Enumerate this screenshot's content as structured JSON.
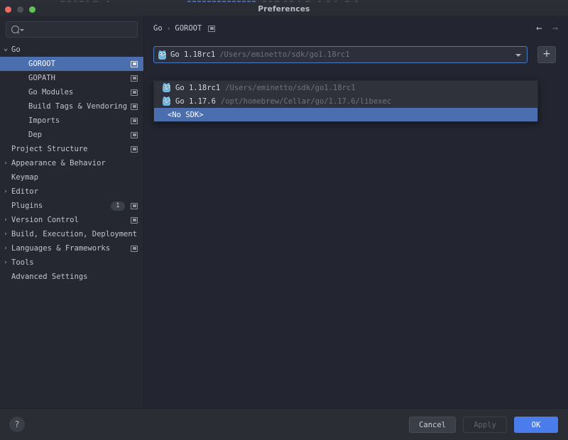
{
  "window": {
    "title": "Preferences",
    "traffic_lights": [
      "close",
      "minimize",
      "zoom"
    ]
  },
  "sidebar": {
    "search": {
      "placeholder": "",
      "value": "",
      "icon": "search-icon"
    },
    "items": [
      {
        "label": "Go",
        "indent": 0,
        "twisty": "expanded",
        "selected": false,
        "gutter": false,
        "count": null
      },
      {
        "label": "GOROOT",
        "indent": 1,
        "twisty": "none",
        "selected": true,
        "gutter": true,
        "count": null
      },
      {
        "label": "GOPATH",
        "indent": 1,
        "twisty": "none",
        "selected": false,
        "gutter": true,
        "count": null
      },
      {
        "label": "Go Modules",
        "indent": 1,
        "twisty": "none",
        "selected": false,
        "gutter": true,
        "count": null
      },
      {
        "label": "Build Tags & Vendoring",
        "indent": 1,
        "twisty": "none",
        "selected": false,
        "gutter": true,
        "count": null
      },
      {
        "label": "Imports",
        "indent": 1,
        "twisty": "none",
        "selected": false,
        "gutter": true,
        "count": null
      },
      {
        "label": "Dep",
        "indent": 1,
        "twisty": "none",
        "selected": false,
        "gutter": true,
        "count": null
      },
      {
        "label": "Project Structure",
        "indent": 0,
        "twisty": "none",
        "selected": false,
        "gutter": true,
        "count": null
      },
      {
        "label": "Appearance & Behavior",
        "indent": 0,
        "twisty": "collapsed",
        "selected": false,
        "gutter": false,
        "count": null
      },
      {
        "label": "Keymap",
        "indent": 0,
        "twisty": "none",
        "selected": false,
        "gutter": false,
        "count": null
      },
      {
        "label": "Editor",
        "indent": 0,
        "twisty": "collapsed",
        "selected": false,
        "gutter": false,
        "count": null
      },
      {
        "label": "Plugins",
        "indent": 0,
        "twisty": "none",
        "selected": false,
        "gutter": true,
        "count": "1"
      },
      {
        "label": "Version Control",
        "indent": 0,
        "twisty": "collapsed",
        "selected": false,
        "gutter": true,
        "count": null
      },
      {
        "label": "Build, Execution, Deployment",
        "indent": 0,
        "twisty": "collapsed",
        "selected": false,
        "gutter": false,
        "count": null
      },
      {
        "label": "Languages & Frameworks",
        "indent": 0,
        "twisty": "collapsed",
        "selected": false,
        "gutter": true,
        "count": null
      },
      {
        "label": "Tools",
        "indent": 0,
        "twisty": "collapsed",
        "selected": false,
        "gutter": false,
        "count": null
      },
      {
        "label": "Advanced Settings",
        "indent": 0,
        "twisty": "none",
        "selected": false,
        "gutter": false,
        "count": null
      }
    ]
  },
  "main": {
    "breadcrumb": {
      "root": "Go",
      "separator": "›",
      "leaf": "GOROOT",
      "icon": "project-settings-icon"
    },
    "nav": {
      "back": "←",
      "forward": "→",
      "back_enabled": true,
      "forward_enabled": false
    },
    "sdk_combo": {
      "selected": {
        "name": "Go 1.18rc1",
        "path": "/Users/eminetto/sdk/go1.18rc1",
        "icon": "go-gopher-icon"
      },
      "chevron": "chevron-down-icon",
      "add_label": "+"
    },
    "sdk_popup": {
      "options": [
        {
          "name": "Go 1.18rc1",
          "path": "/Users/eminetto/sdk/go1.18rc1",
          "icon": "go-gopher-icon",
          "highlighted": false
        },
        {
          "name": "Go 1.17.6",
          "path": "/opt/homebrew/Cellar/go/1.17.6/libexec",
          "icon": "go-gopher-icon",
          "highlighted": false
        },
        {
          "name": "<No SDK>",
          "path": "",
          "icon": null,
          "highlighted": true
        }
      ]
    }
  },
  "footer": {
    "help_label": "?",
    "buttons": [
      {
        "label": "Cancel",
        "style": "cancel",
        "enabled": true
      },
      {
        "label": "Apply",
        "style": "apply",
        "enabled": false
      },
      {
        "label": "OK",
        "style": "ok",
        "enabled": true
      }
    ]
  },
  "colors": {
    "accent": "#4a7ceb",
    "selection": "#4b6eaf",
    "sidebar_bg": "#252830",
    "main_bg": "#232630",
    "chrome_bg": "#2b2d34",
    "popup_bg": "#2f323b",
    "text": "#bfc4cf",
    "muted_text": "#6e737e",
    "gopher_blue": "#6fb7e0"
  }
}
